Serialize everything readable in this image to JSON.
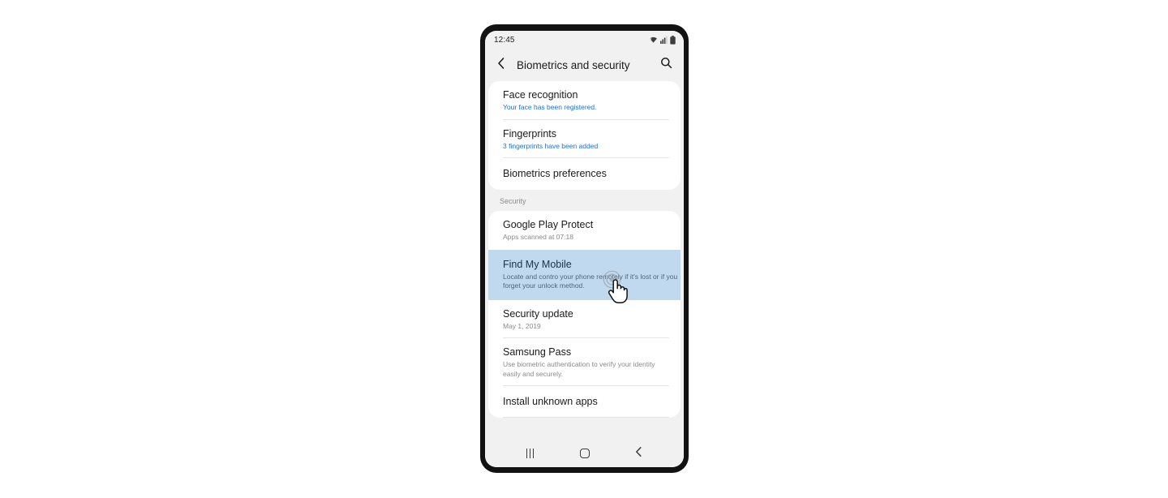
{
  "status_bar": {
    "time": "12:45",
    "icons": [
      "wifi-icon",
      "cellular-signal-icon",
      "battery-icon"
    ]
  },
  "app_bar": {
    "back_icon": "chevron-left-icon",
    "title": "Biometrics and security",
    "search_icon": "search-icon"
  },
  "colors": {
    "screen_bg": "#f1f1f1",
    "card_bg": "#ffffff",
    "selected_row": "#c0d9ef",
    "link_blue": "#1f6fd0",
    "subtitle_gray": "#8a8a8a",
    "title_black": "#1a1a1a",
    "frame_black": "#121212"
  },
  "sections": [
    {
      "label": null,
      "items": [
        {
          "title": "Face recognition",
          "subtitle": "Your face has been registered.",
          "subtitle_style": "link",
          "selected": false
        },
        {
          "title": "Fingerprints",
          "subtitle": "3 fingerprints have been added",
          "subtitle_style": "link",
          "selected": false
        },
        {
          "title": "Biometrics preferences",
          "subtitle": null,
          "subtitle_style": null,
          "selected": false
        }
      ]
    },
    {
      "label": "Security",
      "items": [
        {
          "title": "Google Play Protect",
          "subtitle": "Apps scanned at 07:18",
          "subtitle_style": "gray",
          "selected": false
        },
        {
          "title": "Find My Mobile",
          "subtitle": "Locate and contro your phone remotely if it's lost or if you forget your unlock method.",
          "subtitle_style": "gray",
          "selected": true
        },
        {
          "title": "Security update",
          "subtitle": "May 1, 2019",
          "subtitle_style": "gray",
          "selected": false
        },
        {
          "title": "Samsung Pass",
          "subtitle": "Use biometric authentication to verify your identity easily and securely.",
          "subtitle_style": "gray",
          "selected": false
        },
        {
          "title": "Install unknown apps",
          "subtitle": null,
          "subtitle_style": null,
          "selected": false
        }
      ]
    }
  ],
  "nav_bar": {
    "recents_label": "recent-apps",
    "home_label": "home",
    "back_label": "back"
  },
  "cursor": {
    "type": "pointing-hand",
    "click_indicator": "ripple"
  }
}
